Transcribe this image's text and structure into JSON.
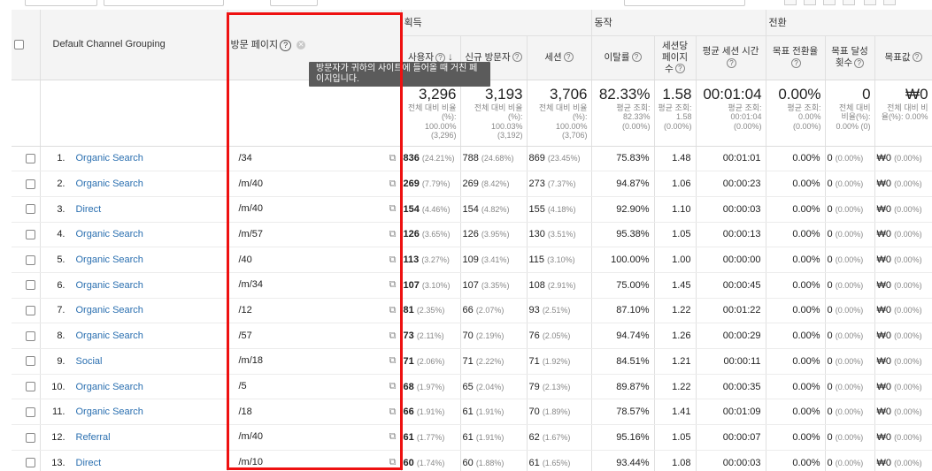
{
  "header": {
    "col_channel": "Default Channel Grouping",
    "col_page": "방문 페이지",
    "group_acquisition": "획득",
    "group_behavior": "동작",
    "group_conversion": "전환",
    "metrics": [
      {
        "key": "users",
        "label": "사용자"
      },
      {
        "key": "new_users",
        "label": "신규 방문자"
      },
      {
        "key": "sessions",
        "label": "세션"
      },
      {
        "key": "bounce",
        "label": "이탈률"
      },
      {
        "key": "pps",
        "label": "세션당 페이지 수"
      },
      {
        "key": "duration",
        "label": "평균 세션 시간"
      },
      {
        "key": "conv_rate",
        "label": "목표 전환율"
      },
      {
        "key": "completions",
        "label": "목표 달성 횟수"
      },
      {
        "key": "goal_value",
        "label": "목표값"
      }
    ]
  },
  "tooltip": {
    "text": "방문자가 귀하의 사이트에 들어올 때 거친 페이지입니다."
  },
  "totals": {
    "users": {
      "value": "3,296",
      "sub1": "전체 대비 비율(%):",
      "sub2": "100.00%",
      "sub3": "(3,296)"
    },
    "new_users": {
      "value": "3,193",
      "sub1": "전체 대비 비율(%):",
      "sub2": "100.03%",
      "sub3": "(3,192)"
    },
    "sessions": {
      "value": "3,706",
      "sub1": "전체 대비 비율(%):",
      "sub2": "100.00%",
      "sub3": "(3,706)"
    },
    "bounce": {
      "value": "82.33%",
      "sub1": "평균 조회:",
      "sub2": "82.33%",
      "sub3": "(0.00%)"
    },
    "pps": {
      "value": "1.58",
      "sub1": "평균 조회:",
      "sub2": "1.58",
      "sub3": "(0.00%)"
    },
    "duration": {
      "value": "00:01:04",
      "sub1": "평균 조회:",
      "sub2": "00:01:04",
      "sub3": "(0.00%)"
    },
    "conv_rate": {
      "value": "0.00%",
      "sub1": "평균 조회:",
      "sub2": "0.00%",
      "sub3": "(0.00%)"
    },
    "completions": {
      "value": "0",
      "sub1": "전체 대비",
      "sub2": "비율(%):",
      "sub3": "0.00% (0)"
    },
    "goal_value": {
      "value": "₩0",
      "sub1": "전체 대비 비",
      "sub2": "율(%): 0.00%",
      "sub3": ""
    }
  },
  "rows": [
    {
      "rank": "1.",
      "channel": "Organic Search",
      "page": "/34",
      "users": "836",
      "users_pct": "(24.21%)",
      "new_users": "788",
      "new_pct": "(24.68%)",
      "sessions": "869",
      "sess_pct": "(23.45%)",
      "bounce": "75.83%",
      "pps": "1.48",
      "duration": "00:01:01",
      "conv_rate": "0.00%",
      "completions": "0",
      "comp_pct": "(0.00%)",
      "goal_value": "₩0",
      "gv_pct": "(0.00%)"
    },
    {
      "rank": "2.",
      "channel": "Organic Search",
      "page": "/m/40",
      "users": "269",
      "users_pct": "(7.79%)",
      "new_users": "269",
      "new_pct": "(8.42%)",
      "sessions": "273",
      "sess_pct": "(7.37%)",
      "bounce": "94.87%",
      "pps": "1.06",
      "duration": "00:00:23",
      "conv_rate": "0.00%",
      "completions": "0",
      "comp_pct": "(0.00%)",
      "goal_value": "₩0",
      "gv_pct": "(0.00%)"
    },
    {
      "rank": "3.",
      "channel": "Direct",
      "page": "/m/40",
      "users": "154",
      "users_pct": "(4.46%)",
      "new_users": "154",
      "new_pct": "(4.82%)",
      "sessions": "155",
      "sess_pct": "(4.18%)",
      "bounce": "92.90%",
      "pps": "1.10",
      "duration": "00:00:03",
      "conv_rate": "0.00%",
      "completions": "0",
      "comp_pct": "(0.00%)",
      "goal_value": "₩0",
      "gv_pct": "(0.00%)"
    },
    {
      "rank": "4.",
      "channel": "Organic Search",
      "page": "/m/57",
      "users": "126",
      "users_pct": "(3.65%)",
      "new_users": "126",
      "new_pct": "(3.95%)",
      "sessions": "130",
      "sess_pct": "(3.51%)",
      "bounce": "95.38%",
      "pps": "1.05",
      "duration": "00:00:13",
      "conv_rate": "0.00%",
      "completions": "0",
      "comp_pct": "(0.00%)",
      "goal_value": "₩0",
      "gv_pct": "(0.00%)"
    },
    {
      "rank": "5.",
      "channel": "Organic Search",
      "page": "/40",
      "users": "113",
      "users_pct": "(3.27%)",
      "new_users": "109",
      "new_pct": "(3.41%)",
      "sessions": "115",
      "sess_pct": "(3.10%)",
      "bounce": "100.00%",
      "pps": "1.00",
      "duration": "00:00:00",
      "conv_rate": "0.00%",
      "completions": "0",
      "comp_pct": "(0.00%)",
      "goal_value": "₩0",
      "gv_pct": "(0.00%)"
    },
    {
      "rank": "6.",
      "channel": "Organic Search",
      "page": "/m/34",
      "users": "107",
      "users_pct": "(3.10%)",
      "new_users": "107",
      "new_pct": "(3.35%)",
      "sessions": "108",
      "sess_pct": "(2.91%)",
      "bounce": "75.00%",
      "pps": "1.45",
      "duration": "00:00:45",
      "conv_rate": "0.00%",
      "completions": "0",
      "comp_pct": "(0.00%)",
      "goal_value": "₩0",
      "gv_pct": "(0.00%)"
    },
    {
      "rank": "7.",
      "channel": "Organic Search",
      "page": "/12",
      "users": "81",
      "users_pct": "(2.35%)",
      "new_users": "66",
      "new_pct": "(2.07%)",
      "sessions": "93",
      "sess_pct": "(2.51%)",
      "bounce": "87.10%",
      "pps": "1.22",
      "duration": "00:01:22",
      "conv_rate": "0.00%",
      "completions": "0",
      "comp_pct": "(0.00%)",
      "goal_value": "₩0",
      "gv_pct": "(0.00%)"
    },
    {
      "rank": "8.",
      "channel": "Organic Search",
      "page": "/57",
      "users": "73",
      "users_pct": "(2.11%)",
      "new_users": "70",
      "new_pct": "(2.19%)",
      "sessions": "76",
      "sess_pct": "(2.05%)",
      "bounce": "94.74%",
      "pps": "1.26",
      "duration": "00:00:29",
      "conv_rate": "0.00%",
      "completions": "0",
      "comp_pct": "(0.00%)",
      "goal_value": "₩0",
      "gv_pct": "(0.00%)"
    },
    {
      "rank": "9.",
      "channel": "Social",
      "page": "/m/18",
      "users": "71",
      "users_pct": "(2.06%)",
      "new_users": "71",
      "new_pct": "(2.22%)",
      "sessions": "71",
      "sess_pct": "(1.92%)",
      "bounce": "84.51%",
      "pps": "1.21",
      "duration": "00:00:11",
      "conv_rate": "0.00%",
      "completions": "0",
      "comp_pct": "(0.00%)",
      "goal_value": "₩0",
      "gv_pct": "(0.00%)"
    },
    {
      "rank": "10.",
      "channel": "Organic Search",
      "page": "/5",
      "users": "68",
      "users_pct": "(1.97%)",
      "new_users": "65",
      "new_pct": "(2.04%)",
      "sessions": "79",
      "sess_pct": "(2.13%)",
      "bounce": "89.87%",
      "pps": "1.22",
      "duration": "00:00:35",
      "conv_rate": "0.00%",
      "completions": "0",
      "comp_pct": "(0.00%)",
      "goal_value": "₩0",
      "gv_pct": "(0.00%)"
    },
    {
      "rank": "11.",
      "channel": "Organic Search",
      "page": "/18",
      "users": "66",
      "users_pct": "(1.91%)",
      "new_users": "61",
      "new_pct": "(1.91%)",
      "sessions": "70",
      "sess_pct": "(1.89%)",
      "bounce": "78.57%",
      "pps": "1.41",
      "duration": "00:01:09",
      "conv_rate": "0.00%",
      "completions": "0",
      "comp_pct": "(0.00%)",
      "goal_value": "₩0",
      "gv_pct": "(0.00%)"
    },
    {
      "rank": "12.",
      "channel": "Referral",
      "page": "/m/40",
      "users": "61",
      "users_pct": "(1.77%)",
      "new_users": "61",
      "new_pct": "(1.91%)",
      "sessions": "62",
      "sess_pct": "(1.67%)",
      "bounce": "95.16%",
      "pps": "1.05",
      "duration": "00:00:07",
      "conv_rate": "0.00%",
      "completions": "0",
      "comp_pct": "(0.00%)",
      "goal_value": "₩0",
      "gv_pct": "(0.00%)"
    },
    {
      "rank": "13.",
      "channel": "Direct",
      "page": "/m/10",
      "users": "60",
      "users_pct": "(1.74%)",
      "new_users": "60",
      "new_pct": "(1.88%)",
      "sessions": "61",
      "sess_pct": "(1.65%)",
      "bounce": "93.44%",
      "pps": "1.08",
      "duration": "00:00:03",
      "conv_rate": "0.00%",
      "completions": "0",
      "comp_pct": "(0.00%)",
      "goal_value": "₩0",
      "gv_pct": "(0.00%)"
    }
  ],
  "colors": {
    "highlight": "#ee1111",
    "link": "#2a6fb0",
    "tooltip_bg": "#5b5b5b"
  }
}
